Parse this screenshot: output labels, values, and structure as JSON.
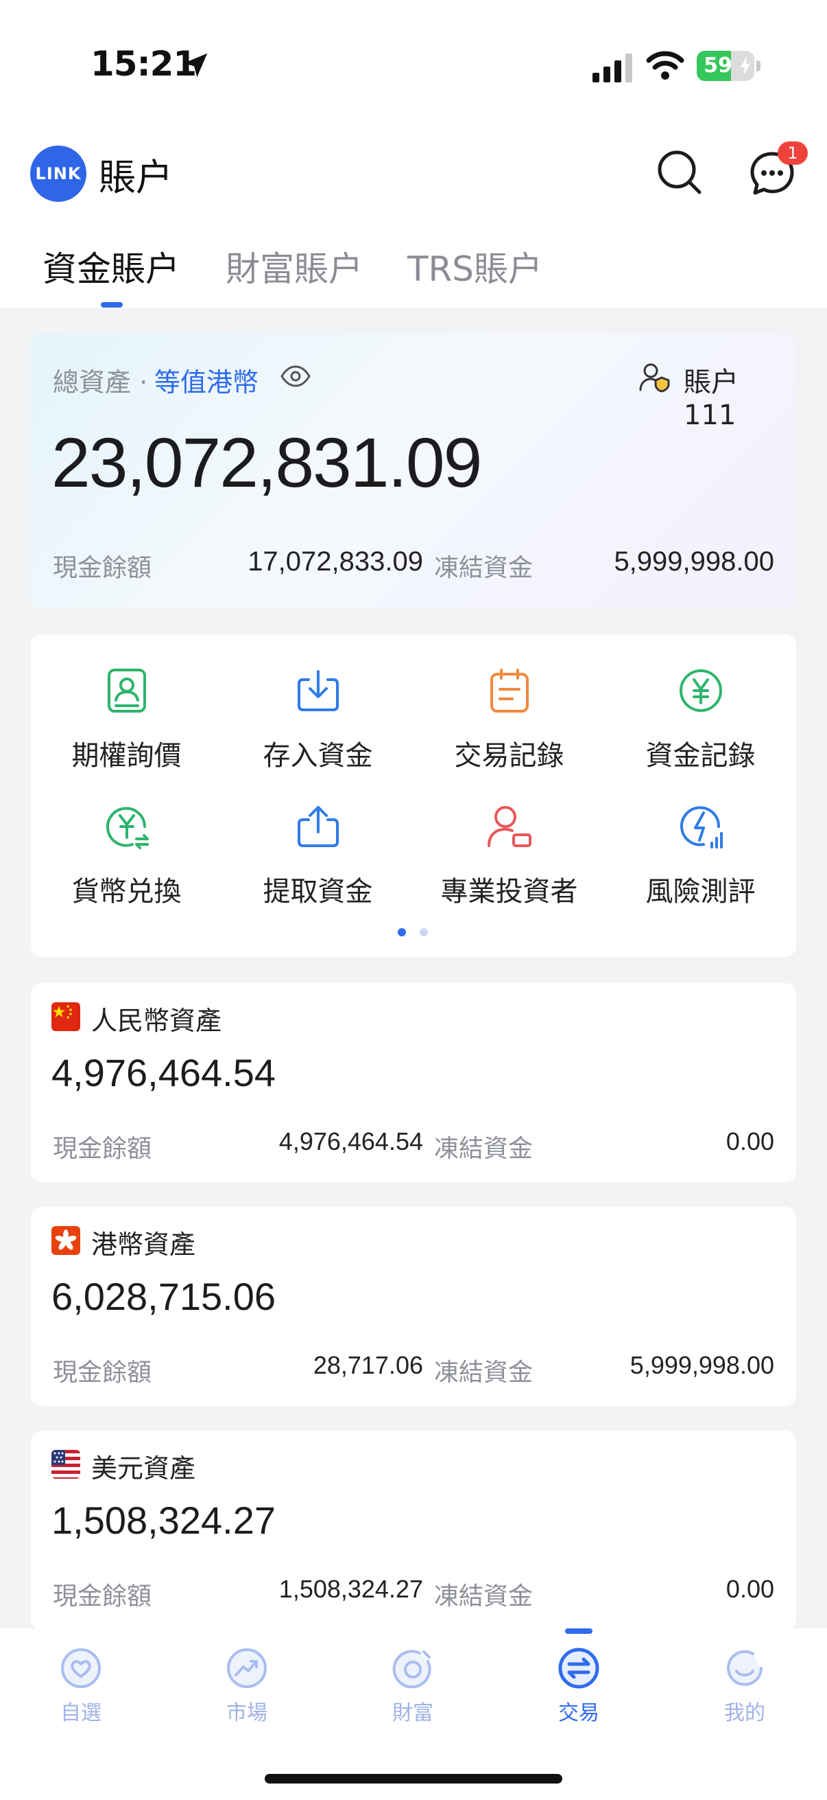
{
  "status_bar": {
    "time": "15:21",
    "battery": "59",
    "battery_level": 0.59
  },
  "header": {
    "logo_text": "LINK",
    "title": "賬户",
    "message_badge": "1"
  },
  "tabs": [
    {
      "label": "資金賬户",
      "active": true
    },
    {
      "label": "財富賬户",
      "active": false
    },
    {
      "label": "TRS賬户",
      "active": false
    }
  ],
  "summary": {
    "label": "總資產 ·",
    "currency_link": "等值港幣",
    "account_label": "賬户 111",
    "total": "23,072,831.09",
    "cash_label": "現金餘額",
    "cash_value": "17,072,833.09",
    "frozen_label": "凍結資金",
    "frozen_value": "5,999,998.00"
  },
  "actions": [
    {
      "label": "期權詢價",
      "icon": "option-inquiry-icon",
      "color": "#2db46c"
    },
    {
      "label": "存入資金",
      "icon": "deposit-icon",
      "color": "#2f7be8"
    },
    {
      "label": "交易記錄",
      "icon": "trade-record-icon",
      "color": "#f08a3e"
    },
    {
      "label": "資金記錄",
      "icon": "fund-record-icon",
      "color": "#2db46c"
    },
    {
      "label": "貨幣兑換",
      "icon": "currency-exchange-icon",
      "color": "#2db46c"
    },
    {
      "label": "提取資金",
      "icon": "withdraw-icon",
      "color": "#2f7be8"
    },
    {
      "label": "專業投資者",
      "icon": "professional-investor-icon",
      "color": "#e8585a"
    },
    {
      "label": "風險測評",
      "icon": "risk-assessment-icon",
      "color": "#2f7be8"
    }
  ],
  "currencies": [
    {
      "flag": "china-flag-icon",
      "title": "人民幣資產",
      "total": "4,976,464.54",
      "cash_label": "現金餘額",
      "cash_value": "4,976,464.54",
      "frozen_label": "凍結資金",
      "frozen_value": "0.00"
    },
    {
      "flag": "hong-kong-flag-icon",
      "title": "港幣資產",
      "total": "6,028,715.06",
      "cash_label": "現金餘額",
      "cash_value": "28,717.06",
      "frozen_label": "凍結資金",
      "frozen_value": "5,999,998.00"
    },
    {
      "flag": "us-flag-icon",
      "title": "美元資產",
      "total": "1,508,324.27",
      "cash_label": "現金餘額",
      "cash_value": "1,508,324.27",
      "frozen_label": "凍結資金",
      "frozen_value": "0.00"
    }
  ],
  "bottom_nav": [
    {
      "label": "自選",
      "icon": "watchlist-icon",
      "active": false
    },
    {
      "label": "市場",
      "icon": "market-icon",
      "active": false
    },
    {
      "label": "財富",
      "icon": "wealth-icon",
      "active": false
    },
    {
      "label": "交易",
      "icon": "trade-icon",
      "active": true
    },
    {
      "label": "我的",
      "icon": "profile-icon",
      "active": false
    }
  ],
  "colors": {
    "accent": "#2f6bed",
    "badge": "#f0423c",
    "battery": "#34c759"
  }
}
